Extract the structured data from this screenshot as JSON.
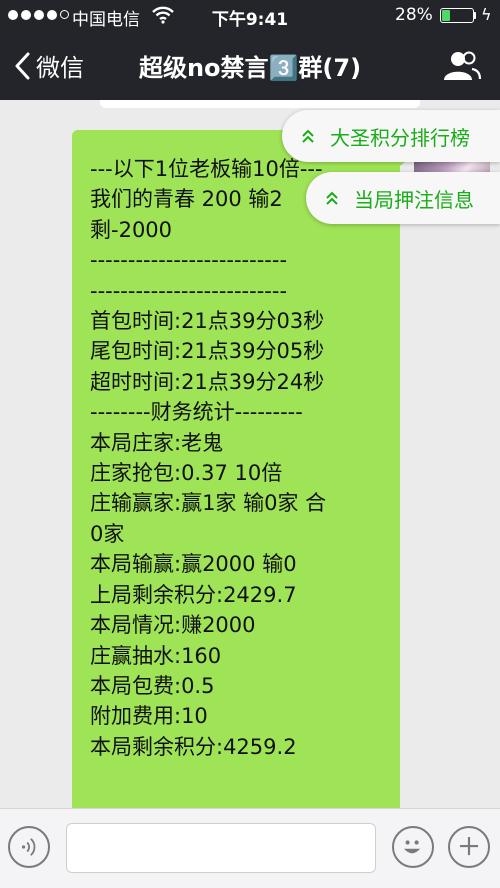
{
  "status": {
    "carrier": "中国电信",
    "time": "下午9:41",
    "battery_pct": "28%",
    "battery_level": 0.28,
    "battery_color": "#4cd964"
  },
  "nav": {
    "back_label": "微信",
    "title": "超级no禁言3️⃣群(7)"
  },
  "floating_tabs": {
    "rank": "大圣积分排行榜",
    "bet": "当局押注信息"
  },
  "message": {
    "lines": [
      "---以下1位老板输10倍---",
      "我们的青春 200 输2",
      "剩-2000",
      "--------------------------",
      "--------------------------",
      "首包时间:21点39分03秒",
      "尾包时间:21点39分05秒",
      "超时时间:21点39分24秒",
      "--------财务统计---------",
      "本局庄家:老鬼",
      "庄家抢包:0.37 10倍",
      "庄输赢家:赢1家 输0家 合",
      "0家",
      "本局输赢:赢2000 输0",
      "上局剩余积分:2429.7",
      "本局情况:赚2000",
      "庄赢抽水:160",
      "本局包费:0.5",
      "附加费用:10",
      "本局剩余积分:4259.2"
    ]
  },
  "colors": {
    "header_bg": "#23252a",
    "bubble": "#9fe356",
    "accent_green": "#1aad19",
    "chat_bg": "#ebebeb"
  },
  "icons": {
    "back": "chevron-left-icon",
    "members": "group-icon",
    "voice": "voice-icon",
    "emoji": "emoji-icon",
    "plus": "plus-icon",
    "expand": "double-chevron-up-icon"
  }
}
